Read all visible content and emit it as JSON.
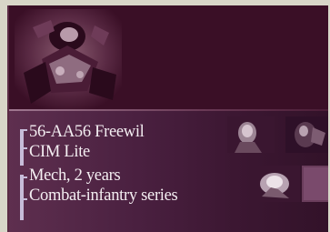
{
  "unit": {
    "designation": "56-AA56 Freewil",
    "model": "CIM Lite",
    "type_age": "Mech, 2 years",
    "series": "Combat-infantry series"
  },
  "icons": {
    "portrait": "mech-portrait-image",
    "thumb1": "pilot-face-thumbnail",
    "thumb2": "mech-side-thumbnail",
    "thumb3": "explosion-thumbnail",
    "thumb4": "empty-slot-thumbnail"
  },
  "colors": {
    "panel_bg": "#3a0f26",
    "info_bg": "#4a2040",
    "text": "#f4eef2",
    "accent_bar": "#c7bcd9"
  }
}
